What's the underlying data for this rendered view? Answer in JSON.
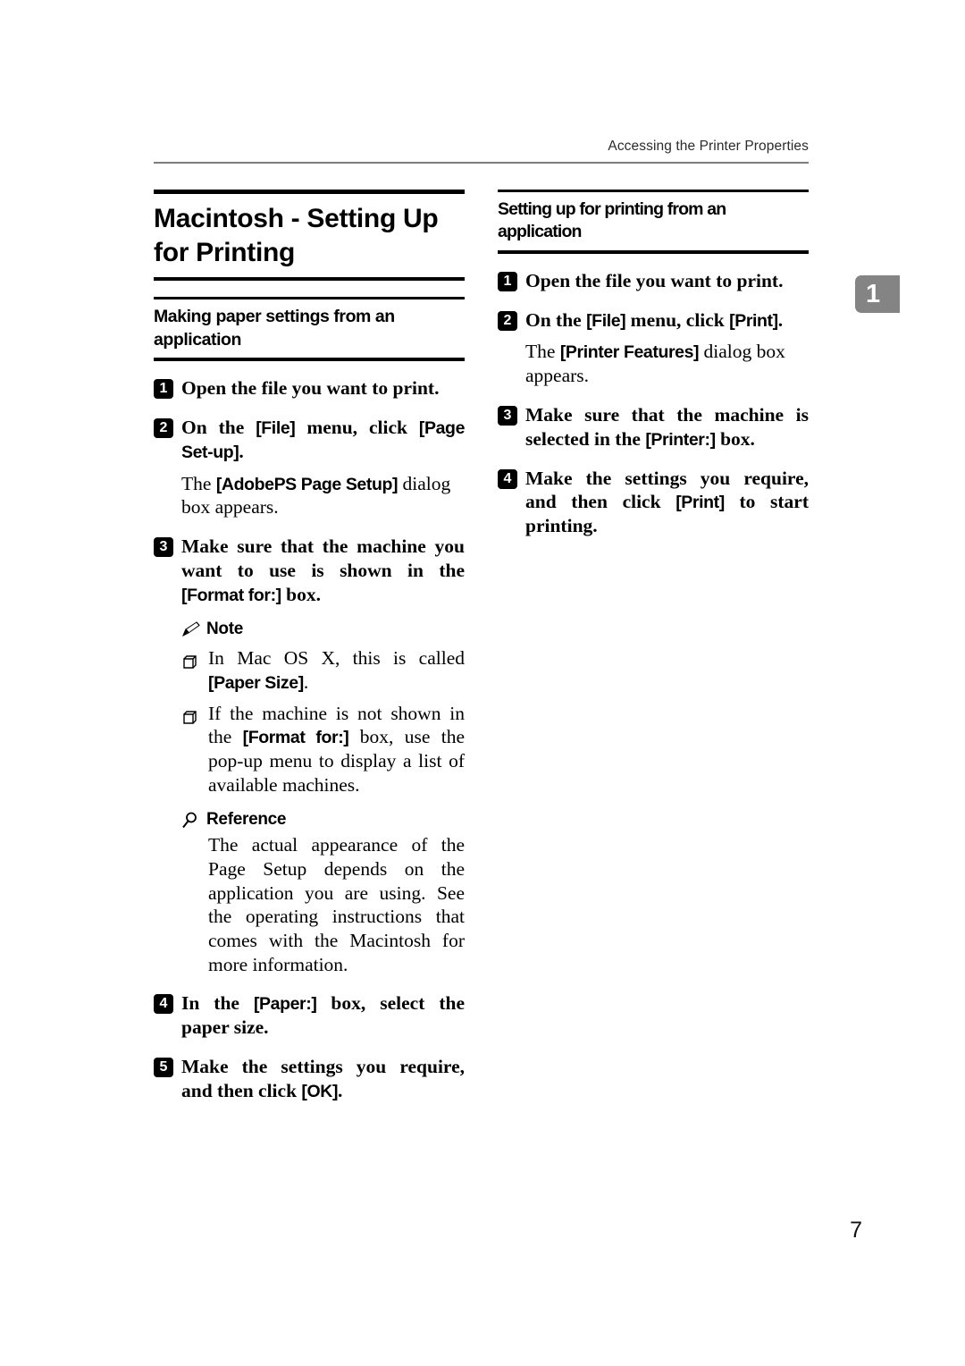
{
  "header": {
    "running_title": "Accessing the Printer Properties",
    "chapter_tab": "1"
  },
  "left_column": {
    "chapter_title": "Macintosh - Setting Up for Printing",
    "section_title": "Making paper settings from an application",
    "steps": [
      {
        "num": "1",
        "text": "Open the file you want to print."
      },
      {
        "num": "2",
        "text_parts": [
          {
            "t": "On the ",
            "ui": false
          },
          {
            "t": "[File]",
            "ui": true
          },
          {
            "t": " menu, click ",
            "ui": false
          },
          {
            "t": "[Page Set-up]",
            "ui": true
          },
          {
            "t": ".",
            "ui": false
          }
        ]
      },
      {
        "num": "3",
        "text_parts": [
          {
            "t": "Make sure that the machine you want to use is shown in the ",
            "ui": false
          },
          {
            "t": "[Format for:]",
            "ui": true
          },
          {
            "t": " box.",
            "ui": false
          }
        ]
      },
      {
        "num": "4",
        "text_parts": [
          {
            "t": "In the ",
            "ui": false
          },
          {
            "t": "[Paper:]",
            "ui": true
          },
          {
            "t": " box, select the paper size.",
            "ui": false
          }
        ]
      },
      {
        "num": "5",
        "text_parts": [
          {
            "t": "Make the settings you require, and then click ",
            "ui": false
          },
          {
            "t": "[OK]",
            "ui": true
          },
          {
            "t": ".",
            "ui": false
          }
        ]
      }
    ],
    "step2_body": [
      {
        "t": "The ",
        "ui": false
      },
      {
        "t": "[AdobePS Page Setup]",
        "ui": true
      },
      {
        "t": " dialog box appears.",
        "ui": false
      }
    ],
    "note": {
      "label": "Note",
      "icon": "pencil-icon",
      "items": [
        [
          {
            "t": "In Mac OS X, this is called ",
            "ui": false
          },
          {
            "t": "[Paper Size]",
            "ui": true
          },
          {
            "t": ".",
            "ui": false
          }
        ],
        [
          {
            "t": "If the machine is not shown in the ",
            "ui": false
          },
          {
            "t": "[Format for:]",
            "ui": true
          },
          {
            "t": " box, use the pop-up menu to display a list of available machines.",
            "ui": false
          }
        ]
      ]
    },
    "reference": {
      "label": "Reference",
      "icon": "magnifier-icon",
      "text": "The actual appearance of the Page Setup depends on the application you are using. See the operating instructions that comes with the Macintosh for more information."
    }
  },
  "right_column": {
    "section_title": "Setting up for printing from an application",
    "steps": [
      {
        "num": "1",
        "text": "Open the file you want to print."
      },
      {
        "num": "2",
        "text_parts": [
          {
            "t": "On the ",
            "ui": false
          },
          {
            "t": "[File]",
            "ui": true
          },
          {
            "t": " menu, click ",
            "ui": false
          },
          {
            "t": "[Print]",
            "ui": true
          },
          {
            "t": ".",
            "ui": false
          }
        ]
      },
      {
        "num": "3",
        "text_parts": [
          {
            "t": "Make sure that the machine is selected in the ",
            "ui": false
          },
          {
            "t": "[Printer:]",
            "ui": true
          },
          {
            "t": " box.",
            "ui": false
          }
        ]
      },
      {
        "num": "4",
        "text_parts": [
          {
            "t": "Make the settings you require, and then click ",
            "ui": false
          },
          {
            "t": "[Print]",
            "ui": true
          },
          {
            "t": " to start printing.",
            "ui": false
          }
        ]
      }
    ],
    "step2_body": [
      {
        "t": "The ",
        "ui": false
      },
      {
        "t": "[Printer Features]",
        "ui": true
      },
      {
        "t": " dialog box appears.",
        "ui": false
      }
    ]
  },
  "footer": {
    "page_number": "7"
  },
  "colors": {
    "rule_black": "#000000",
    "header_rule_gray": "#7d7d7d",
    "chapter_tab_gray": "#848484",
    "text_black": "#000000"
  }
}
